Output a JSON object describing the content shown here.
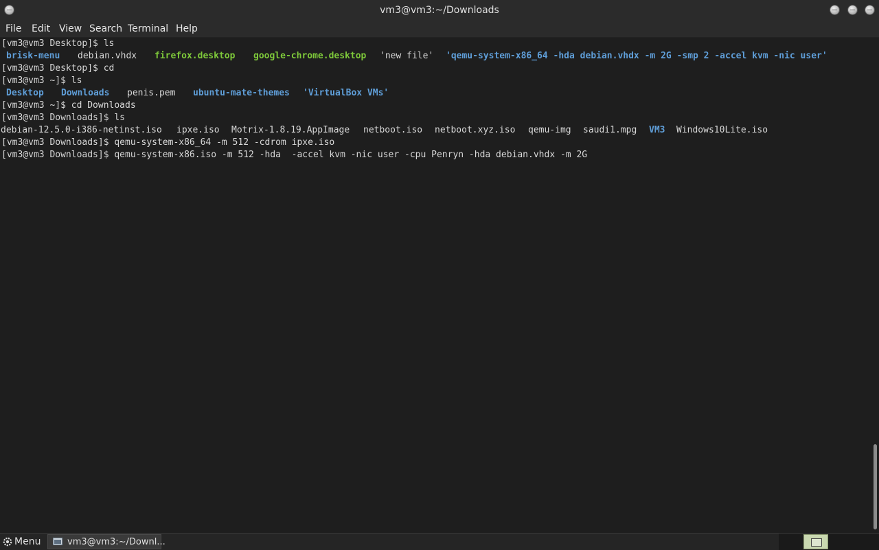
{
  "window": {
    "title": "vm3@vm3:~/Downloads"
  },
  "menubar": {
    "items": [
      "File",
      "Edit",
      "View",
      "Search",
      "Terminal",
      "Help"
    ]
  },
  "terminal": {
    "lines": [
      {
        "text": "[vm3@vm3 Desktop]$ ls"
      },
      {
        "tokens": [
          {
            "text": "brisk-menu",
            "kind": "dir"
          },
          {
            "text": "debian.vhdx",
            "kind": "file"
          },
          {
            "text": "firefox.desktop",
            "kind": "exe"
          },
          {
            "text": "google-chrome.desktop",
            "kind": "exe"
          },
          {
            "text": "'new file'",
            "kind": "file"
          },
          {
            "text": "'qemu-system-x86_64 -hda debian.vhdx -m 2G -smp 2 -accel kvm -nic user'",
            "kind": "qdir"
          }
        ]
      },
      {
        "text": "[vm3@vm3 Desktop]$ cd"
      },
      {
        "text": "[vm3@vm3 ~]$ ls"
      },
      {
        "tokens": [
          {
            "text": "Desktop",
            "kind": "dir"
          },
          {
            "text": "Downloads",
            "kind": "dir"
          },
          {
            "text": "penis.pem",
            "kind": "file"
          },
          {
            "text": "ubuntu-mate-themes",
            "kind": "dir"
          },
          {
            "text": "'VirtualBox VMs'",
            "kind": "qdir"
          }
        ]
      },
      {
        "text": "[vm3@vm3 ~]$ cd Downloads"
      },
      {
        "text": "[vm3@vm3 Downloads]$ ls"
      },
      {
        "tokens": [
          {
            "text": "debian-12.5.0-i386-netinst.iso",
            "kind": "file"
          },
          {
            "text": "ipxe.iso",
            "kind": "file"
          },
          {
            "text": "Motrix-1.8.19.AppImage",
            "kind": "file"
          },
          {
            "text": "netboot.iso",
            "kind": "file"
          },
          {
            "text": "netboot.xyz.iso",
            "kind": "file"
          },
          {
            "text": "qemu-img",
            "kind": "file"
          },
          {
            "text": "saudi1.mpg",
            "kind": "file"
          },
          {
            "text": "VM3",
            "kind": "dir"
          },
          {
            "text": "Windows10Lite.iso",
            "kind": "file"
          }
        ]
      },
      {
        "text": "[vm3@vm3 Downloads]$ qemu-system-x86_64 -m 512 -cdrom ipxe.iso"
      },
      {
        "text": "[vm3@vm3 Downloads]$ qemu-system-x86.iso -m 512 -hda  -accel kvm -nic user -cpu Penryn -hda debian.vhdx -m 2G"
      }
    ]
  },
  "taskbar": {
    "menu_label": "Menu",
    "task_label": "vm3@vm3:~/Downl..."
  },
  "icons": {
    "window_menu": "window-menu-icon",
    "minimize": "minimize-icon",
    "maximize": "maximize-icon",
    "close": "close-icon",
    "menu": "gear-icon",
    "task": "terminal-window-icon",
    "workspace": "workspace-switcher-icon"
  },
  "colors": {
    "directory": "#5f9ed8",
    "executable": "#7ec93a",
    "text": "#d8d8d8",
    "background": "#1e1e1e"
  }
}
